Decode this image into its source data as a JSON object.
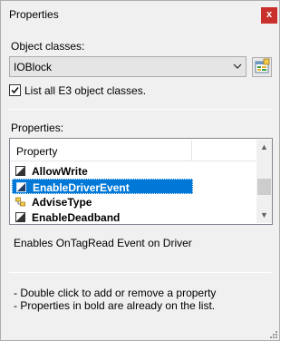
{
  "window": {
    "title": "Properties",
    "close_glyph": "x",
    "close_color": "#c9302c"
  },
  "object_classes": {
    "label": "Object classes:",
    "selected": "IOBlock",
    "browse_icon": "object-browser-icon"
  },
  "list_all": {
    "label": "List all E3 object classes.",
    "checked": true
  },
  "properties": {
    "label": "Properties:",
    "column_header": "Property",
    "selection_color": "#0078d7",
    "items": [
      {
        "name": "AllowWrite",
        "icon": "property-icon",
        "selected": false
      },
      {
        "name": "EnableDriverEvent",
        "icon": "property-icon",
        "selected": true
      },
      {
        "name": "AdviseType",
        "icon": "enum-property-icon",
        "selected": false
      },
      {
        "name": "EnableDeadband",
        "icon": "property-icon",
        "selected": false
      }
    ]
  },
  "description": "Enables OnTagRead Event on Driver",
  "help": {
    "line1": "- Double click to add or remove a property",
    "line2": "- Properties in bold are already on the list."
  }
}
